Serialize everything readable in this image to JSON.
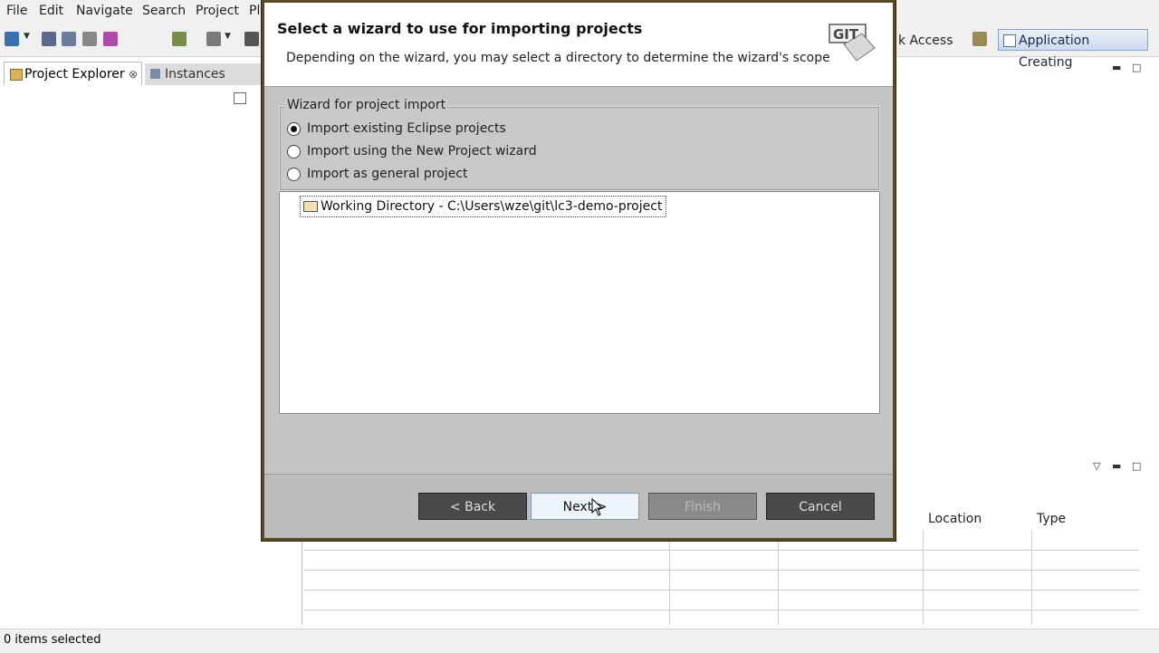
{
  "menubar": {
    "items": [
      "File",
      "Edit",
      "Navigate",
      "Search",
      "Project",
      "Pl"
    ]
  },
  "toolbar": {
    "quick_access": "k Access",
    "perspective": "Application Creating"
  },
  "left_panel": {
    "tab_active": "Project Explorer",
    "tab_close": "⊗",
    "tab_inactive": "Instances"
  },
  "grid": {
    "columns": [
      "Location",
      "Type"
    ]
  },
  "status_bar": {
    "text": "0 items selected"
  },
  "dialog": {
    "title": "Select a wizard to use for importing projects",
    "description": "Depending on the wizard, you may select a directory to determine the wizard's scope",
    "logo_text": "GIT",
    "group_label": "Wizard for project import",
    "options": [
      {
        "label": "Import existing Eclipse projects",
        "selected": true
      },
      {
        "label": "Import using the New Project wizard",
        "selected": false
      },
      {
        "label": "Import as general project",
        "selected": false
      }
    ],
    "tree_item": "Working Directory - C:\\Users\\wze\\git\\lc3-demo-project",
    "buttons": {
      "back": "< Back",
      "next": "Next >",
      "finish": "Finish",
      "cancel": "Cancel"
    }
  }
}
